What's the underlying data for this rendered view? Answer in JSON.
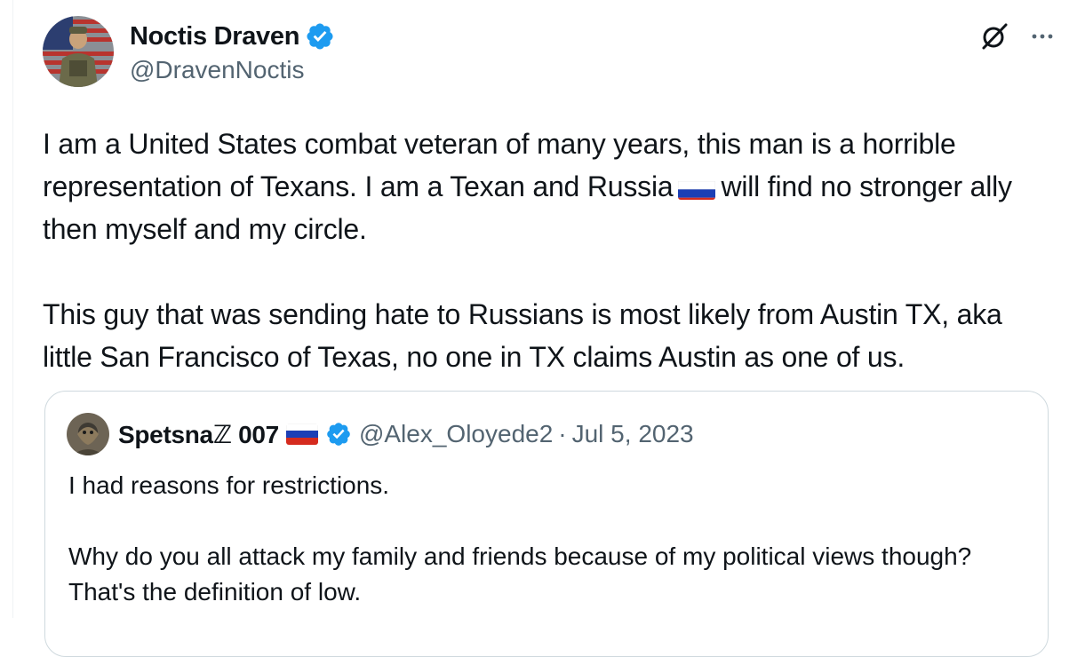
{
  "tweet": {
    "author_name": "Noctis Draven",
    "author_handle": "@DravenNoctis",
    "paragraph1_part1": "I am a United States combat veteran of many years, this man is a horrible representation of Texans. I am a Texan and Russia",
    "paragraph1_part2": "will find no stronger ally then myself and my circle.",
    "paragraph2": "This guy that was sending hate to Russians is most likely from Austin TX, aka little San Francisco of Texas, no one in TX claims Austin as one of us."
  },
  "quote": {
    "author_name": "Spetsnaℤ 007",
    "author_handle": "@Alex_Oloyede2",
    "separator": "·",
    "date": "Jul 5, 2023",
    "paragraph1": "I had reasons for restrictions.",
    "paragraph2": "Why do you all attack my family and friends because of my political views though?  That's the definition of low."
  },
  "icons": {
    "verified": "verified-badge-icon",
    "grok": "grok-icon",
    "more": "more-options-icon",
    "flag": "russia-flag-icon"
  },
  "colors": {
    "verified_blue": "#1d9bf0",
    "secondary_text": "#536471",
    "primary_text": "#0f1419",
    "border": "#cfd9de"
  }
}
